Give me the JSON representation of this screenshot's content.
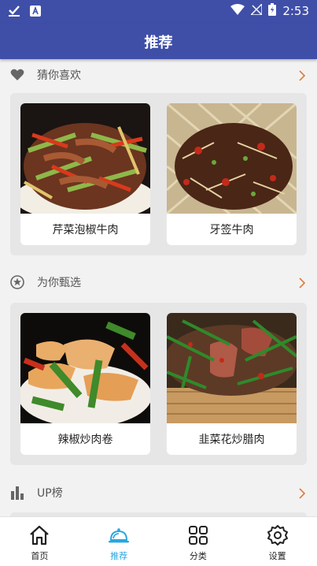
{
  "status_bar": {
    "time": "2:53"
  },
  "app_bar": {
    "title": "推荐"
  },
  "sections": [
    {
      "title": "猜你喜欢",
      "icon": "heart-icon",
      "items": [
        {
          "name": "芹菜泡椒牛肉"
        },
        {
          "name": "牙签牛肉"
        }
      ]
    },
    {
      "title": "为你甄选",
      "icon": "star-badge-icon",
      "items": [
        {
          "name": "辣椒炒肉卷"
        },
        {
          "name": "韭菜花炒腊肉"
        }
      ]
    },
    {
      "title": "UP榜",
      "icon": "bar-chart-icon"
    }
  ],
  "tabs": [
    {
      "label": "首页",
      "icon": "home-icon",
      "active": false
    },
    {
      "label": "推荐",
      "icon": "dish-cloche-icon",
      "active": true
    },
    {
      "label": "分类",
      "icon": "grid-icon",
      "active": false
    },
    {
      "label": "设置",
      "icon": "settings-gear-icon",
      "active": false
    }
  ],
  "colors": {
    "primary": "#3f4fa8",
    "active_tab": "#2aa6e0",
    "arrow": "#e07a3c"
  }
}
